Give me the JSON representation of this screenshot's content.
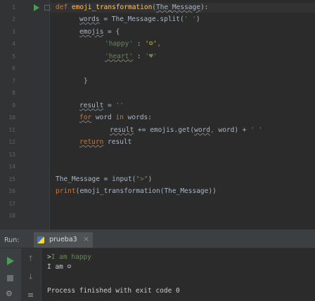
{
  "editor": {
    "line_numbers": [
      "1",
      "2",
      "3",
      "4",
      "5",
      "6",
      "7",
      "8",
      "9",
      "10",
      "11",
      "12",
      "13",
      "14",
      "15",
      "16",
      "17",
      "18"
    ],
    "code": {
      "l1_def": "def",
      "l1_fn": "emoji_transformation",
      "l1_open": "(",
      "l1_param": "The_Message",
      "l1_close": "):",
      "l2_var": "words",
      "l2_rest": " = The_Message.split(",
      "l2_str": "' '",
      "l2_end": ")",
      "l3_var": "emojis",
      "l3_rest": " = {",
      "l4_key": "'happy'",
      "l4_colon": " : ",
      "l4_val": "'☺'",
      "l4_comma": ",",
      "l5_key": "'heart'",
      "l5_colon": " : ",
      "l5_val": "'♥'",
      "l7_brace": "}",
      "l9_var": "result",
      "l9_rest": " = ",
      "l9_str": "''",
      "l10_for": "for",
      "l10_rest1": " word ",
      "l10_in": "in",
      "l10_rest2": " words:",
      "l11_var": "result",
      "l11_rest": " += emojis.get(",
      "l11_arg": "word",
      "l11_comma": ", ",
      "l11_rest2": "word) + ",
      "l11_str": "' '",
      "l12_ret": "return",
      "l12_rest": " result",
      "l15_var": "The_Message",
      "l15_rest": " = input(",
      "l15_str": "\">\"",
      "l15_end": ")",
      "l16_print": "print",
      "l16_rest": "(emoji_transformation(The_Message))"
    }
  },
  "run_panel": {
    "run_label": "Run:",
    "tab_label": "prueba3",
    "tab_close": "×"
  },
  "console": {
    "prompt": ">",
    "input_text": "I am happy",
    "output_line": "I am ☺",
    "finish_message": "Process finished with exit code 0"
  },
  "colors": {
    "background": "#2b2b2b",
    "keyword": "#cc7832",
    "function": "#ffc66d",
    "string": "#6a8759",
    "run_green": "#499c54"
  }
}
